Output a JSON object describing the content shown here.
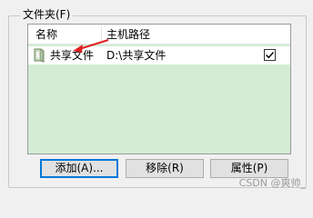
{
  "groupbox": {
    "title": "文件夹(F)"
  },
  "listview": {
    "columns": [
      "名称",
      "主机路径"
    ],
    "rows": [
      {
        "name": "共享文件",
        "path": "D:\\共享文件",
        "checked": true
      }
    ]
  },
  "buttons": {
    "add": "添加(A)...",
    "remove": "移除(R)",
    "properties": "属性(P)"
  },
  "watermark": "CSDN @爽帅_",
  "icons": {
    "share": "shared-folder-icon",
    "checkbox": "checkmark-icon"
  },
  "colors": {
    "list_background": "#d3ecd3",
    "annotation_arrow": "#e02020",
    "default_button_border": "#0078d7"
  }
}
